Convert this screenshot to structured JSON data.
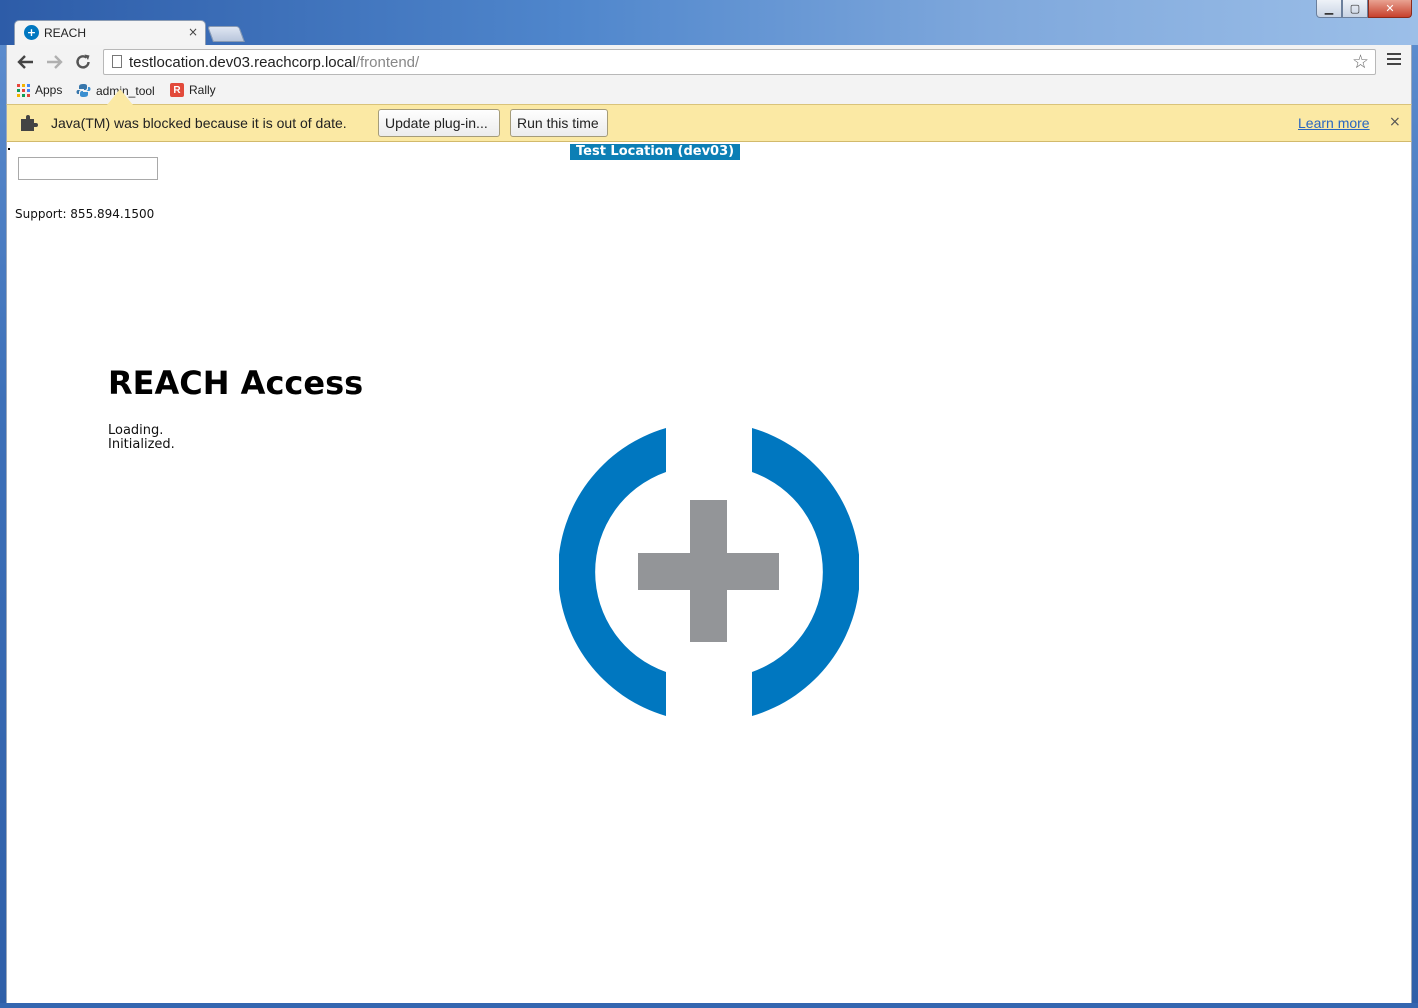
{
  "browser": {
    "tab_title": "REACH",
    "tab_close": "×",
    "url_host": "testlocation.dev03.reachcorp.local",
    "url_path": "/frontend/",
    "bookmarks": [
      {
        "label": "Apps"
      },
      {
        "label": "admin_tool"
      },
      {
        "label": "Rally"
      }
    ]
  },
  "infobar": {
    "message": "Java(TM) was blocked because it is out of date.",
    "update_label": "Update plug-in...",
    "run_label": "Run this time",
    "learn_more": "Learn more",
    "close": "×"
  },
  "page": {
    "env_badge": "Test Location (dev03)",
    "support": "Support: 855.894.1500",
    "title": "REACH Access",
    "status_lines": [
      "Loading.",
      "Initialized."
    ]
  },
  "colors": {
    "brand_blue": "#0077c0",
    "cross_gray": "#939598",
    "infobar_bg": "#fbe9a4",
    "badge_bg": "#0c7fb5"
  }
}
